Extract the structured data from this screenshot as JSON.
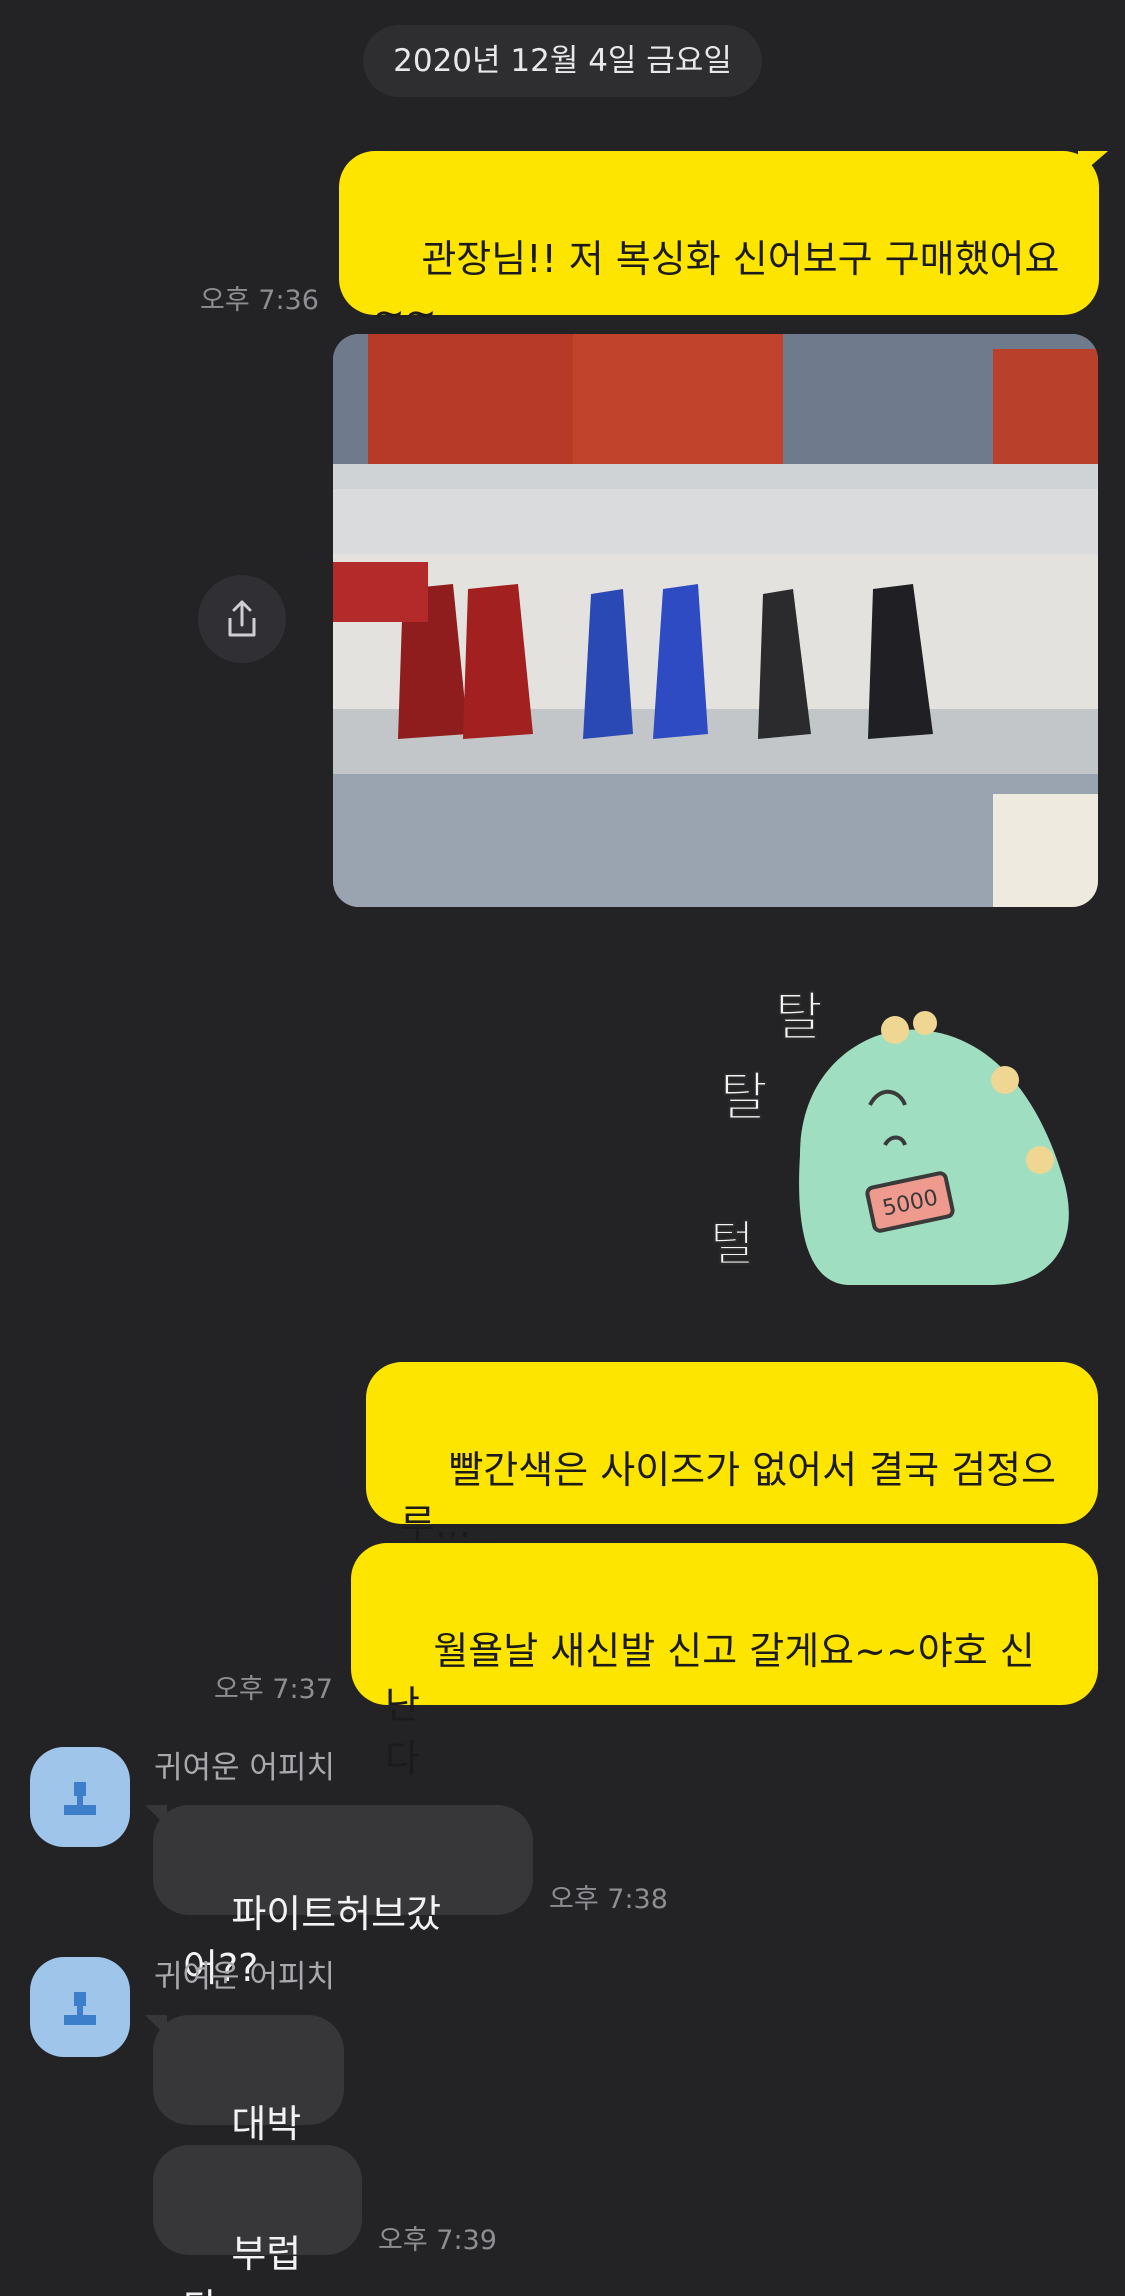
{
  "date_divider": "2020년 12월 4일 금요일",
  "messages": {
    "m1": {
      "text": "관장님!! 저 복싱화 신어보구 구매했어요\n~~",
      "time": "오후 7:36"
    },
    "m2": {
      "text": "빨간색은 사이즈가 없어서 결국 검정으\n루..."
    },
    "m3": {
      "text": "월욜날 새신발 신고 갈게요~~야호 신난\n다",
      "time": "오후 7:37"
    },
    "r1": {
      "sender": "귀여운 어피치",
      "text": "파이트허브갔어??",
      "time": "오후 7:38"
    },
    "r2": {
      "sender": "귀여운 어피치",
      "text": "대박 ㅋ"
    },
    "r3": {
      "text": "부럽다~",
      "time": "오후 7:39"
    }
  },
  "sticker": {
    "label": "탈탈털",
    "price_tag": "5000"
  },
  "icons": {
    "share": "share-icon",
    "avatar": "default-profile-icon"
  },
  "colors": {
    "background": "#232326",
    "my_bubble": "#fee500",
    "their_bubble": "#37373a"
  }
}
